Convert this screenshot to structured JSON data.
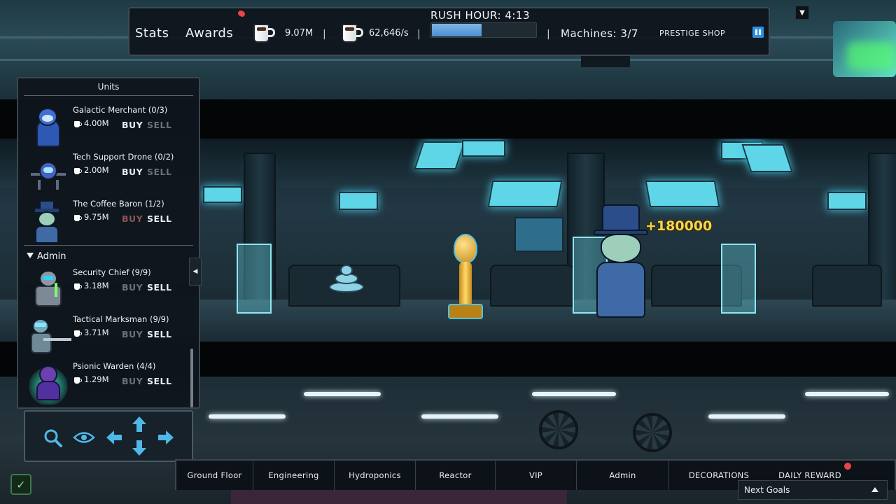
{
  "hud": {
    "stats_label": "Stats",
    "awards_label": "Awards",
    "coffee_total": "9.07M",
    "coffee_rate": "62,646/s",
    "separator": "|",
    "rush_hour_label": "RUSH HOUR: 4:13",
    "rush_hour_progress": 0.47,
    "machines_label": "Machines: 3/7",
    "prestige_shop_label": "PRESTIGE SHOP",
    "pause_icon": "pause-icon",
    "dropdown_icon": "chevron-down-icon"
  },
  "floating_reward": "+180000",
  "units_panel": {
    "title": "Units",
    "units": [
      {
        "name": "Galactic Merchant (0/3)",
        "cost": "4.00M",
        "buy": "BUY",
        "sell": "SELL"
      },
      {
        "name": "Tech Support Drone (0/2)",
        "cost": "2.00M",
        "buy": "BUY",
        "sell": "SELL"
      },
      {
        "name": "The Coffee Baron (1/2)",
        "cost": "9.75M",
        "buy": "BUY",
        "sell": "SELL"
      }
    ],
    "admin_section": {
      "label": "Admin",
      "units": [
        {
          "name": "Security Chief (9/9)",
          "cost": "3.18M",
          "buy": "BUY",
          "sell": "SELL"
        },
        {
          "name": "Tactical Marksman (9/9)",
          "cost": "3.71M",
          "buy": "BUY",
          "sell": "SELL"
        },
        {
          "name": "Psionic Warden (4/4)",
          "cost": "1.29M",
          "buy": "BUY",
          "sell": "SELL"
        }
      ]
    },
    "collapse_icon": "chevron-left-icon"
  },
  "camera_controls": {
    "icons": [
      "search-icon",
      "eye-icon",
      "arrow-left-icon",
      "arrow-up-icon",
      "arrow-down-icon",
      "arrow-right-icon"
    ]
  },
  "tabs": [
    {
      "label": "Ground Floor"
    },
    {
      "label": "Engineering"
    },
    {
      "label": "Hydroponics"
    },
    {
      "label": "Reactor"
    },
    {
      "label": "VIP"
    },
    {
      "label": "Admin"
    },
    {
      "label": "DECORATIONS"
    },
    {
      "label": "DAILY REWARD"
    }
  ],
  "next_goals_label": "Next Goals",
  "check_icon": "check-icon",
  "colors": {
    "accent_blue": "#4d8fd0",
    "reward_gold": "#f3d54e",
    "notification_red": "#e84545"
  }
}
